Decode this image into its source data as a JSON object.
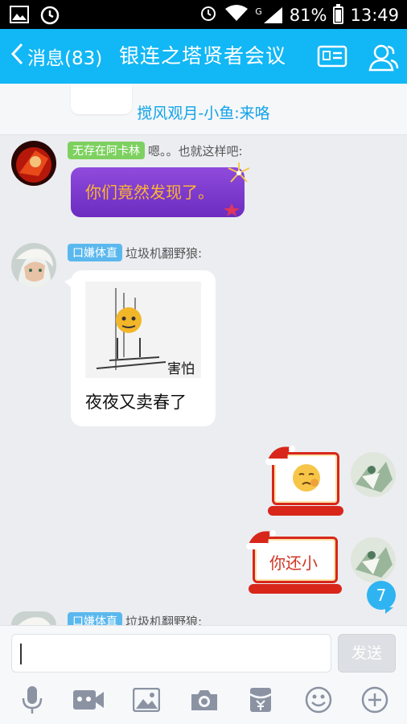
{
  "status_bar": {
    "signal_label": "G",
    "battery": "81%",
    "time": "13:49"
  },
  "header": {
    "back_label": "消息(83)",
    "title": "银连之塔贤者会议"
  },
  "notice": {
    "text": "搅风观月-小鱼:来咯"
  },
  "messages": [
    {
      "badge": "无存在阿卡林",
      "sender": "嗯。。也就这样吧:",
      "text": "你们竟然发现了。"
    },
    {
      "badge": "口嫌体直",
      "sender": "垃圾机翻野狼:",
      "sticker_caption": "害怕",
      "text": "夜夜又卖春了"
    },
    {
      "text": "你还小"
    },
    {
      "badge": "口嫌体直",
      "sender": "垃圾机翻野狼:"
    }
  ],
  "unread_count": "7",
  "composer": {
    "input_value": "",
    "send_label": "发送"
  },
  "colors": {
    "brand": "#12b7f5",
    "badge_green": "#7ed160",
    "badge_blue": "#5bb8ee"
  }
}
